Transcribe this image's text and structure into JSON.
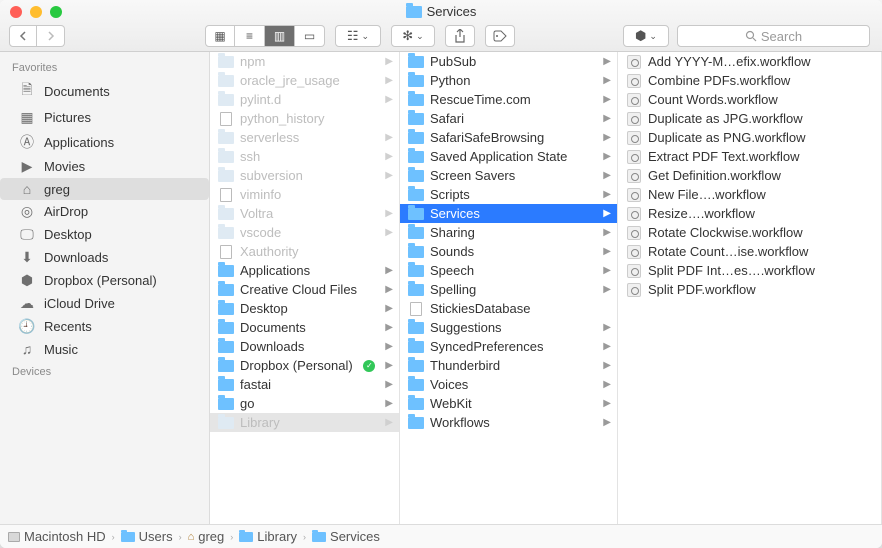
{
  "window": {
    "title": "Services",
    "search_placeholder": "Search"
  },
  "sidebar": {
    "sections": [
      {
        "header": "Favorites",
        "items": [
          {
            "icon": "doc",
            "label": "Documents",
            "selected": false
          },
          {
            "icon": "pictures",
            "label": "Pictures",
            "selected": false
          },
          {
            "icon": "apps",
            "label": "Applications",
            "selected": false
          },
          {
            "icon": "movies",
            "label": "Movies",
            "selected": false
          },
          {
            "icon": "home",
            "label": "greg",
            "selected": true
          },
          {
            "icon": "airdrop",
            "label": "AirDrop",
            "selected": false
          },
          {
            "icon": "desktop",
            "label": "Desktop",
            "selected": false
          },
          {
            "icon": "downloads",
            "label": "Downloads",
            "selected": false
          },
          {
            "icon": "dropbox",
            "label": "Dropbox (Personal)",
            "selected": false
          },
          {
            "icon": "icloud",
            "label": "iCloud Drive",
            "selected": false
          },
          {
            "icon": "recents",
            "label": "Recents",
            "selected": false
          },
          {
            "icon": "music",
            "label": "Music",
            "selected": false
          }
        ]
      },
      {
        "header": "Devices",
        "items": []
      }
    ]
  },
  "columns": {
    "col1": [
      {
        "label": "npm",
        "type": "folder",
        "dim": true
      },
      {
        "label": "oracle_jre_usage",
        "type": "folder",
        "dim": true
      },
      {
        "label": "pylint.d",
        "type": "folder",
        "dim": true
      },
      {
        "label": "python_history",
        "type": "file",
        "dim": true,
        "no_arrow": true
      },
      {
        "label": "serverless",
        "type": "folder",
        "dim": true
      },
      {
        "label": "ssh",
        "type": "folder",
        "dim": true
      },
      {
        "label": "subversion",
        "type": "folder",
        "dim": true
      },
      {
        "label": "viminfo",
        "type": "file",
        "dim": true,
        "no_arrow": true
      },
      {
        "label": "Voltra",
        "type": "folder",
        "dim": true
      },
      {
        "label": "vscode",
        "type": "folder",
        "dim": true
      },
      {
        "label": "Xauthority",
        "type": "file",
        "dim": true,
        "no_arrow": true
      },
      {
        "label": "Applications",
        "type": "folder"
      },
      {
        "label": "Creative Cloud Files",
        "type": "folder"
      },
      {
        "label": "Desktop",
        "type": "folder"
      },
      {
        "label": "Documents",
        "type": "folder"
      },
      {
        "label": "Downloads",
        "type": "folder"
      },
      {
        "label": "Dropbox (Personal)",
        "type": "folder",
        "badge": "green"
      },
      {
        "label": "fastai",
        "type": "folder"
      },
      {
        "label": "go",
        "type": "folder"
      },
      {
        "label": "Library",
        "type": "folder",
        "dim": true,
        "selected": "grey"
      }
    ],
    "col2": [
      {
        "label": "PubSub",
        "type": "folder"
      },
      {
        "label": "Python",
        "type": "folder"
      },
      {
        "label": "RescueTime.com",
        "type": "folder"
      },
      {
        "label": "Safari",
        "type": "folder"
      },
      {
        "label": "SafariSafeBrowsing",
        "type": "folder"
      },
      {
        "label": "Saved Application State",
        "type": "folder"
      },
      {
        "label": "Screen Savers",
        "type": "folder"
      },
      {
        "label": "Scripts",
        "type": "folder"
      },
      {
        "label": "Services",
        "type": "folder",
        "selected": "blue"
      },
      {
        "label": "Sharing",
        "type": "folder"
      },
      {
        "label": "Sounds",
        "type": "folder"
      },
      {
        "label": "Speech",
        "type": "folder"
      },
      {
        "label": "Spelling",
        "type": "folder"
      },
      {
        "label": "StickiesDatabase",
        "type": "file",
        "no_arrow": true
      },
      {
        "label": "Suggestions",
        "type": "folder"
      },
      {
        "label": "SyncedPreferences",
        "type": "folder"
      },
      {
        "label": "Thunderbird",
        "type": "folder"
      },
      {
        "label": "Voices",
        "type": "folder"
      },
      {
        "label": "WebKit",
        "type": "folder"
      },
      {
        "label": "Workflows",
        "type": "folder"
      }
    ],
    "col3": [
      {
        "label": "Add YYYY-M…efix.workflow",
        "type": "workflow"
      },
      {
        "label": "Combine PDFs.workflow",
        "type": "workflow"
      },
      {
        "label": "Count Words.workflow",
        "type": "workflow"
      },
      {
        "label": "Duplicate as JPG.workflow",
        "type": "workflow"
      },
      {
        "label": "Duplicate as PNG.workflow",
        "type": "workflow"
      },
      {
        "label": "Extract PDF Text.workflow",
        "type": "workflow"
      },
      {
        "label": "Get Definition.workflow",
        "type": "workflow"
      },
      {
        "label": "New File….workflow",
        "type": "workflow"
      },
      {
        "label": "Resize….workflow",
        "type": "workflow"
      },
      {
        "label": "Rotate Clockwise.workflow",
        "type": "workflow"
      },
      {
        "label": "Rotate Count…ise.workflow",
        "type": "workflow"
      },
      {
        "label": "Split PDF Int…es….workflow",
        "type": "workflow"
      },
      {
        "label": "Split PDF.workflow",
        "type": "workflow"
      }
    ]
  },
  "pathbar": [
    {
      "icon": "hd",
      "label": "Macintosh HD"
    },
    {
      "icon": "folder",
      "label": "Users"
    },
    {
      "icon": "home",
      "label": "greg"
    },
    {
      "icon": "folder",
      "label": "Library"
    },
    {
      "icon": "folder",
      "label": "Services"
    }
  ]
}
